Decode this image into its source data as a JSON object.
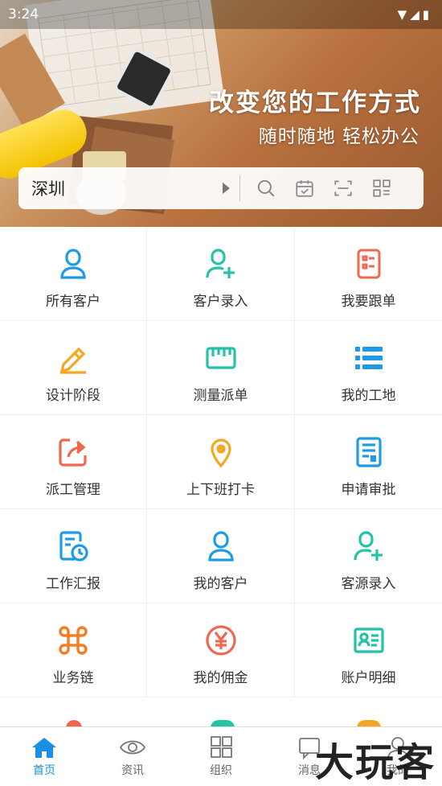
{
  "status_bar": {
    "time": "3:24",
    "icons": "▼◢▮"
  },
  "banner": {
    "headline": "改变您的工作方式",
    "subline": "随时随地 轻松办公"
  },
  "search_bar": {
    "city": "深圳",
    "icons": [
      "search-icon",
      "calendar-check-icon",
      "scan-icon",
      "qrcode-icon"
    ]
  },
  "grid": [
    {
      "label": "所有客户",
      "icon": "person-icon",
      "color": "#1e9be6"
    },
    {
      "label": "客户录入",
      "icon": "person-add-icon",
      "color": "#25c2a6"
    },
    {
      "label": "我要跟单",
      "icon": "checklist-icon",
      "color": "#f0674f"
    },
    {
      "label": "设计阶段",
      "icon": "pencil-icon",
      "color": "#f5a623"
    },
    {
      "label": "测量派单",
      "icon": "ruler-icon",
      "color": "#25c2a6"
    },
    {
      "label": "我的工地",
      "icon": "list-icon",
      "color": "#1e9be6"
    },
    {
      "label": "派工管理",
      "icon": "share-icon",
      "color": "#f0674f"
    },
    {
      "label": "上下班打卡",
      "icon": "location-pin-icon",
      "color": "#f5a623"
    },
    {
      "label": "申请审批",
      "icon": "document-icon",
      "color": "#1e9be6"
    },
    {
      "label": "工作汇报",
      "icon": "report-clock-icon",
      "color": "#1e9be6"
    },
    {
      "label": "我的客户",
      "icon": "person-icon",
      "color": "#1e9be6"
    },
    {
      "label": "客源录入",
      "icon": "person-add-icon",
      "color": "#25c2a6"
    },
    {
      "label": "业务链",
      "icon": "command-icon",
      "color": "#f57c1f"
    },
    {
      "label": "我的佣金",
      "icon": "yen-coin-icon",
      "color": "#f0674f"
    },
    {
      "label": "账户明细",
      "icon": "id-card-icon",
      "color": "#25c2a6"
    }
  ],
  "tabs": [
    {
      "label": "首页",
      "icon": "home-icon",
      "active": true
    },
    {
      "label": "资讯",
      "icon": "eye-icon",
      "active": false
    },
    {
      "label": "组织",
      "icon": "grid-icon",
      "active": false
    },
    {
      "label": "消息",
      "icon": "message-icon",
      "active": false
    },
    {
      "label": "我的",
      "icon": "user-icon",
      "active": false
    }
  ],
  "watermark": "大玩客",
  "colors": {
    "accent": "#1890e8"
  }
}
